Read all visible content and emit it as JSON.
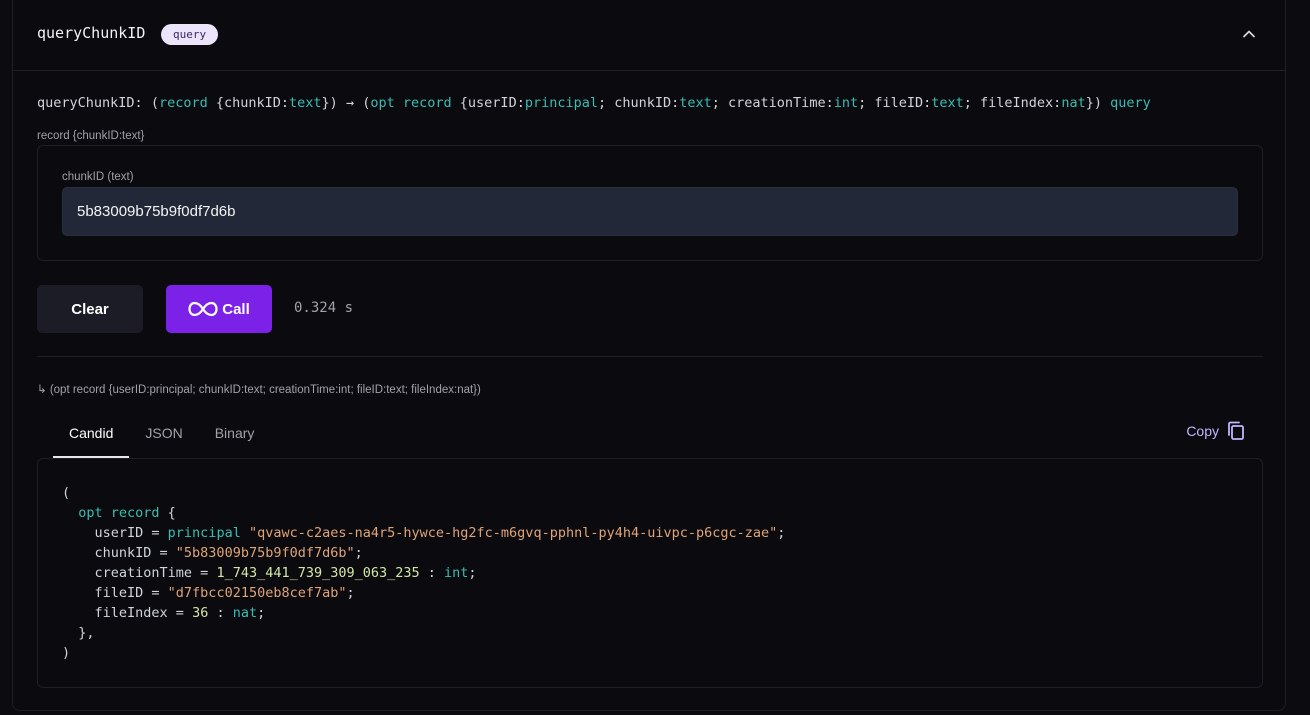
{
  "header": {
    "method_name": "queryChunkID",
    "badge": "query"
  },
  "signature": {
    "name": "queryChunkID:",
    "open_paren": "(",
    "arg_record_kw": "record",
    "arg_open": "{chunkID:",
    "arg_text_type": "text",
    "arg_close": "})",
    "arrow": "→",
    "ret_open": "(",
    "ret_opt_record_kw": "opt record",
    "ret_brace_user": "{userID:",
    "ret_principal": "principal",
    "ret_chunk": "; chunkID:",
    "ret_text1": "text",
    "ret_creation": "; creationTime:",
    "ret_int": "int",
    "ret_fileid": "; fileID:",
    "ret_text2": "text",
    "ret_fileindex": "; fileIndex:",
    "ret_nat": "nat",
    "ret_close": "})",
    "mode": "query"
  },
  "argument": {
    "record_label": "record {chunkID:text}",
    "field_label": "chunkID (text)",
    "field_value": "5b83009b75b9f0df7d6b"
  },
  "actions": {
    "clear_label": "Clear",
    "call_label": "Call",
    "timing": "0.324 s"
  },
  "result": {
    "return_type": "↳ (opt record {userID:principal; chunkID:text; creationTime:int; fileID:text; fileIndex:nat})",
    "tabs": [
      "Candid",
      "JSON",
      "Binary"
    ],
    "active_tab": "Candid",
    "copy_label": "Copy",
    "code": {
      "open": "(",
      "opt_record": "opt record",
      "brace_open": " {",
      "user_key": "userID = ",
      "principal_kw": "principal",
      "user_value": "\"qvawc-c2aes-na4r5-hywce-hg2fc-m6gvq-pphnl-py4h4-uivpc-p6cgc-zae\"",
      "chunk_key": "chunkID = ",
      "chunk_value": "\"5b83009b75b9f0df7d6b\"",
      "creation_key": "creationTime = ",
      "creation_value": "1_743_441_739_309_063_235",
      "int_kw": "int",
      "fileid_key": "fileID = ",
      "fileid_value": "\"d7fbcc02150eb8cef7ab\"",
      "fileindex_key": "fileIndex = ",
      "fileindex_value": "36",
      "nat_kw": "nat",
      "brace_close": "},",
      "close": ")"
    }
  },
  "colors": {
    "accent": "#7c22e8",
    "keyword": "#38bdb2",
    "string": "#e0a476",
    "number": "#d4e8a6"
  }
}
